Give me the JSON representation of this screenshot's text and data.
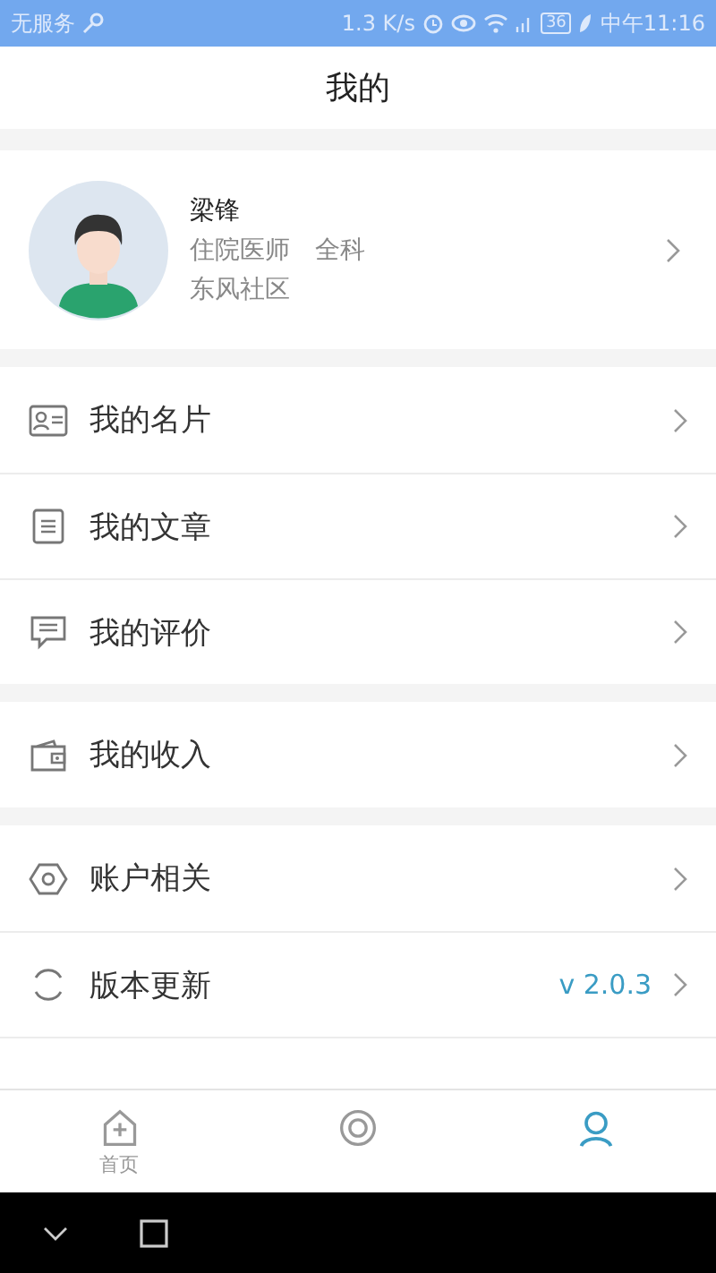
{
  "status_bar": {
    "carrier": "无服务",
    "speed": "1.3 K/s",
    "battery": "36",
    "time": "中午11:16"
  },
  "header": {
    "title": "我的"
  },
  "profile": {
    "name": "梁锋",
    "title": "住院医师",
    "department": "全科",
    "community": "东风社区"
  },
  "groups": [
    {
      "items": [
        {
          "label": "我的名片"
        },
        {
          "label": "我的文章"
        },
        {
          "label": "我的评价"
        }
      ]
    },
    {
      "items": [
        {
          "label": "我的收入"
        }
      ]
    },
    {
      "items": [
        {
          "label": "账户相关"
        },
        {
          "label": "版本更新",
          "value": "v 2.0.3"
        }
      ]
    }
  ],
  "tab_bar": [
    {
      "label": "首页",
      "selected": false
    },
    {
      "selected": false
    },
    {
      "selected": true
    }
  ]
}
